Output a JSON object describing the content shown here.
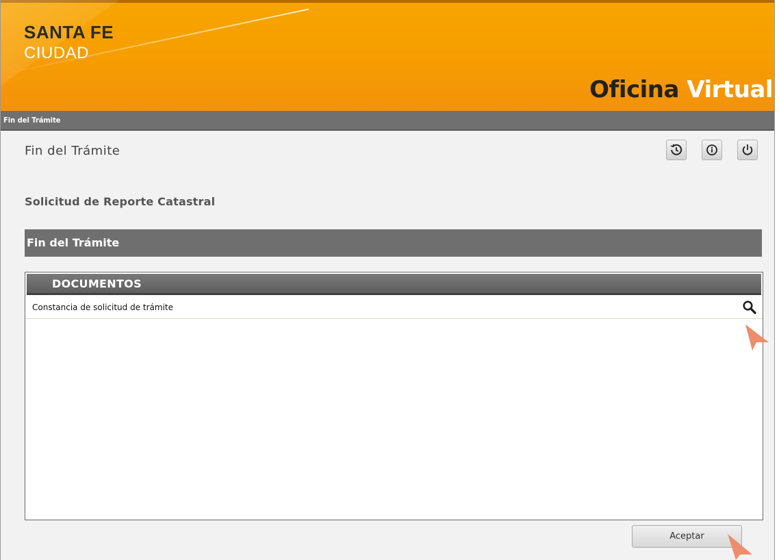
{
  "header": {
    "logo_line1": "SANTA FE",
    "logo_line2": "CIUDAD",
    "brand_word1": "Oficina",
    "brand_word2": "Virtual",
    "colors": {
      "orange": "#f6a000",
      "gray_bar": "#707070"
    }
  },
  "breadcrumb": "Fin del Trámite",
  "page": {
    "title": "Fin del Trámite",
    "subtitle": "Solicitud de Reporte Catastral",
    "section_title": "Fin del Trámite"
  },
  "toolbar": {
    "icons": [
      "history-icon",
      "info-icon",
      "power-icon"
    ]
  },
  "documents": {
    "header": "DOCUMENTOS",
    "items": [
      {
        "label": "Constancia de solicitud de trámite",
        "action_icon": "search-icon"
      }
    ]
  },
  "actions": {
    "accept_label": "Aceptar"
  }
}
